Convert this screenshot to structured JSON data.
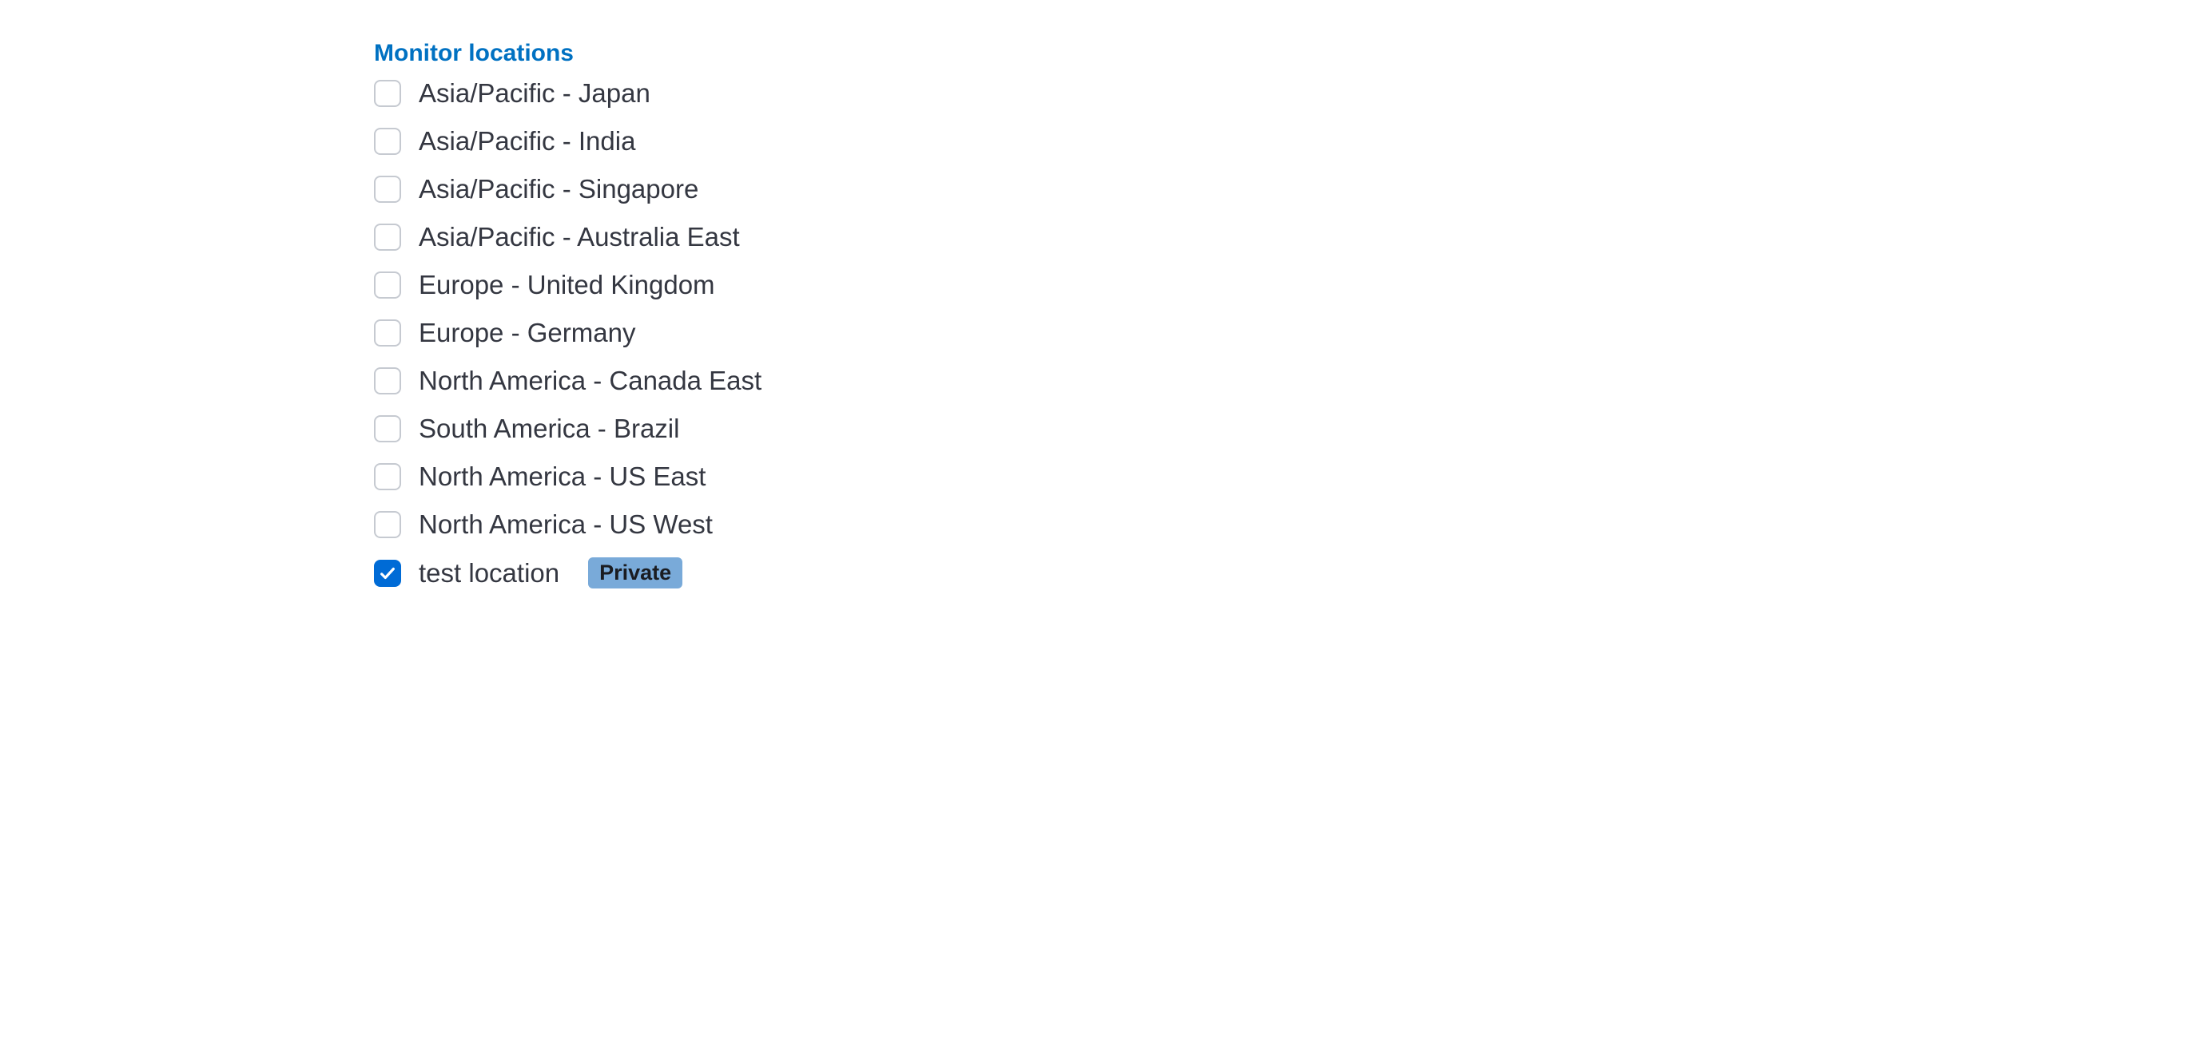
{
  "section": {
    "title": "Monitor locations"
  },
  "locations": [
    {
      "label": "Asia/Pacific - Japan",
      "checked": false,
      "badge": null
    },
    {
      "label": "Asia/Pacific - India",
      "checked": false,
      "badge": null
    },
    {
      "label": "Asia/Pacific - Singapore",
      "checked": false,
      "badge": null
    },
    {
      "label": "Asia/Pacific - Australia East",
      "checked": false,
      "badge": null
    },
    {
      "label": "Europe - United Kingdom",
      "checked": false,
      "badge": null
    },
    {
      "label": "Europe - Germany",
      "checked": false,
      "badge": null
    },
    {
      "label": "North America - Canada East",
      "checked": false,
      "badge": null
    },
    {
      "label": "South America - Brazil",
      "checked": false,
      "badge": null
    },
    {
      "label": "North America - US East",
      "checked": false,
      "badge": null
    },
    {
      "label": "North America - US West",
      "checked": false,
      "badge": null
    },
    {
      "label": "test location",
      "checked": true,
      "badge": "Private"
    }
  ]
}
